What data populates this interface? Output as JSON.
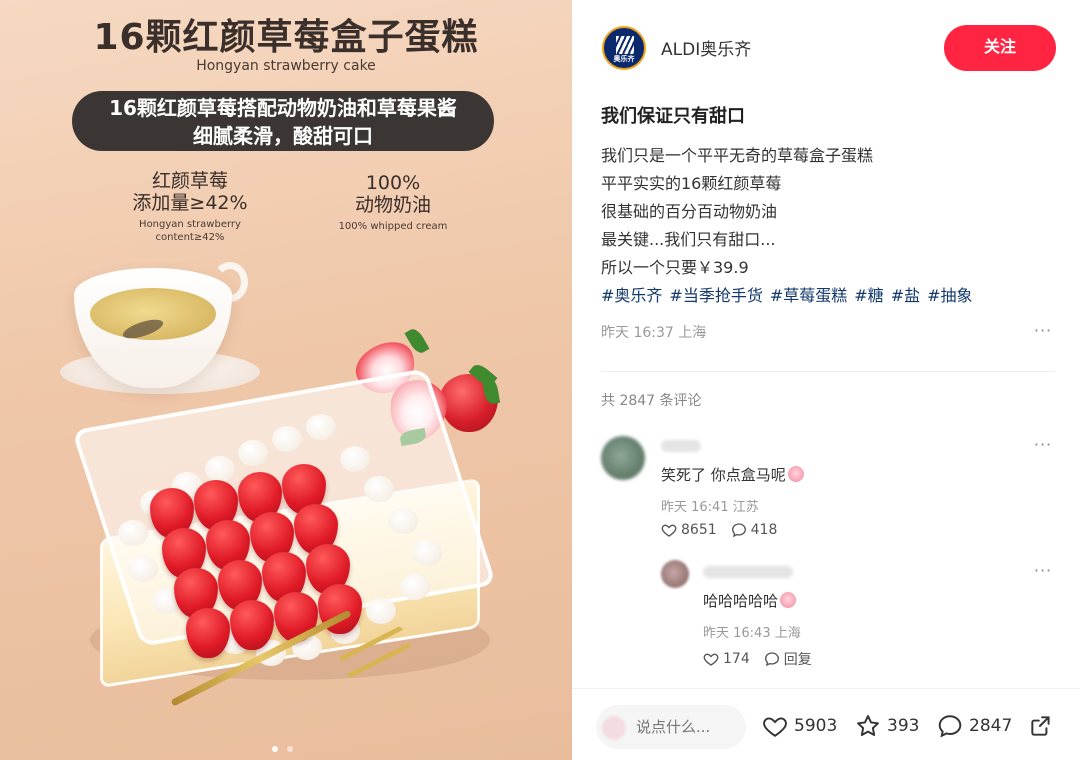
{
  "image": {
    "title": "16颗红颜草莓盒子蛋糕",
    "subtitle": "Hongyan strawberry cake",
    "pill_line1": "16颗红颜草莓搭配动物奶油和草莓果酱",
    "pill_line2": "细腻柔滑，酸甜可口",
    "stat1_line1": "红颜草莓",
    "stat1_line2": "添加量≥42%",
    "stat1_en1": "Hongyan strawberry",
    "stat1_en2": "content≥42%",
    "stat2_line1": "100%",
    "stat2_line2": "动物奶油",
    "stat2_en": "100% whipped cream",
    "carousel_total": 2,
    "carousel_active": 1
  },
  "author": {
    "name": "ALDI奥乐齐",
    "avatar_text": "奥乐齐"
  },
  "follow_label": "关注",
  "post": {
    "title": "我们保证只有甜口",
    "lines": [
      "我们只是一个平平无奇的草莓盒子蛋糕",
      "平平实实的16颗红颜草莓",
      "很基础的百分百动物奶油",
      "最关键...我们只有甜口...",
      "所以一个只要￥39.9"
    ],
    "tags": [
      "#奥乐齐",
      "#当季抢手货",
      "#草莓蛋糕",
      "#糖",
      "#盐",
      "#抽象"
    ],
    "time": "昨天 16:37",
    "location": "上海"
  },
  "comments_header": "共 2847 条评论",
  "comments": [
    {
      "text": "笑死了 你点盒马呢",
      "time": "昨天 16:41",
      "location": "江苏",
      "likes": "8651",
      "replies": "418"
    },
    {
      "text": "哈哈哈哈哈",
      "time": "昨天 16:43",
      "location": "上海",
      "likes": "174",
      "reply_label": "回复"
    }
  ],
  "bottom": {
    "input_placeholder": "说点什么...",
    "likes": "5903",
    "stars": "393",
    "comments": "2847"
  },
  "colors": {
    "accent": "#ff2442",
    "tag": "#13386c",
    "muted": "#999999"
  },
  "icons": [
    "more-icon",
    "heart-icon",
    "comment-icon",
    "star-icon",
    "share-icon"
  ]
}
